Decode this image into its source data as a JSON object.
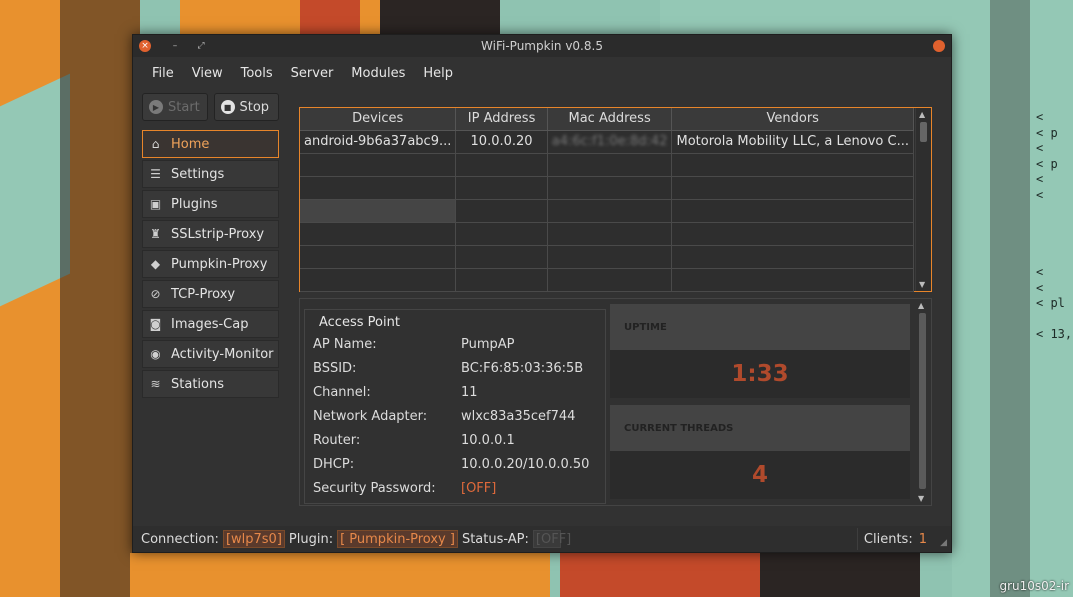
{
  "window": {
    "title": "WiFi-Pumpkin v0.8.5"
  },
  "menu": [
    "File",
    "View",
    "Tools",
    "Server",
    "Modules",
    "Help"
  ],
  "controls": {
    "start_label": "Start",
    "stop_label": "Stop"
  },
  "sidebar": {
    "items": [
      {
        "label": "Home",
        "icon": "home-icon",
        "active": true
      },
      {
        "label": "Settings",
        "icon": "settings-icon"
      },
      {
        "label": "Plugins",
        "icon": "image-icon"
      },
      {
        "label": "SSLstrip-Proxy",
        "icon": "spy-icon"
      },
      {
        "label": "Pumpkin-Proxy",
        "icon": "box-icon"
      },
      {
        "label": "TCP-Proxy",
        "icon": "satellite-icon"
      },
      {
        "label": "Images-Cap",
        "icon": "camera-icon"
      },
      {
        "label": "Activity-Monitor",
        "icon": "eye-icon"
      },
      {
        "label": "Stations",
        "icon": "wifi-icon"
      }
    ]
  },
  "devices": {
    "columns": [
      "Devices",
      "IP Address",
      "Mac Address",
      "Vendors"
    ],
    "rows": [
      [
        "android-9b6a37abc9...",
        "10.0.0.20",
        "a4:6c:f1:0e:8d:42",
        "Motorola Mobility LLC, a Lenovo C..."
      ]
    ]
  },
  "access_point": {
    "title": "Access Point",
    "fields": [
      {
        "label": "AP Name:",
        "value": "PumpAP"
      },
      {
        "label": "BSSID:",
        "value": "BC:F6:85:03:36:5B"
      },
      {
        "label": "Channel:",
        "value": "11"
      },
      {
        "label": "Network Adapter:",
        "value": "wlxc83a35cef744"
      },
      {
        "label": "Router:",
        "value": "10.0.0.1"
      },
      {
        "label": "DHCP:",
        "value": "10.0.0.20/10.0.0.50"
      },
      {
        "label": "Security Password:",
        "value": "[OFF]"
      }
    ]
  },
  "stats": {
    "uptime_label": "UPTIME",
    "uptime_value": "1:33",
    "threads_label": "CURRENT THREADS",
    "threads_value": "4"
  },
  "statusbar": {
    "connection_label": "Connection:",
    "connection_value": "[wlp7s0]",
    "plugin_label": "Plugin:",
    "plugin_value": "[ Pumpkin-Proxy ]",
    "status_ap_label": "Status-AP:",
    "status_ap_value": "[OFF]",
    "clients_label": "Clients:",
    "clients_value": "1"
  },
  "wallpaper": {
    "code_lines": "< \n< p\n< \n< p\n< \n< \n\n\n\n\n< \n< \n< pl\n\n< 13,",
    "watermark": "gru10s02-ir"
  },
  "colors": {
    "accent": "#e8852a",
    "value_red": "#b04a2c",
    "off": "#e06a3b"
  }
}
